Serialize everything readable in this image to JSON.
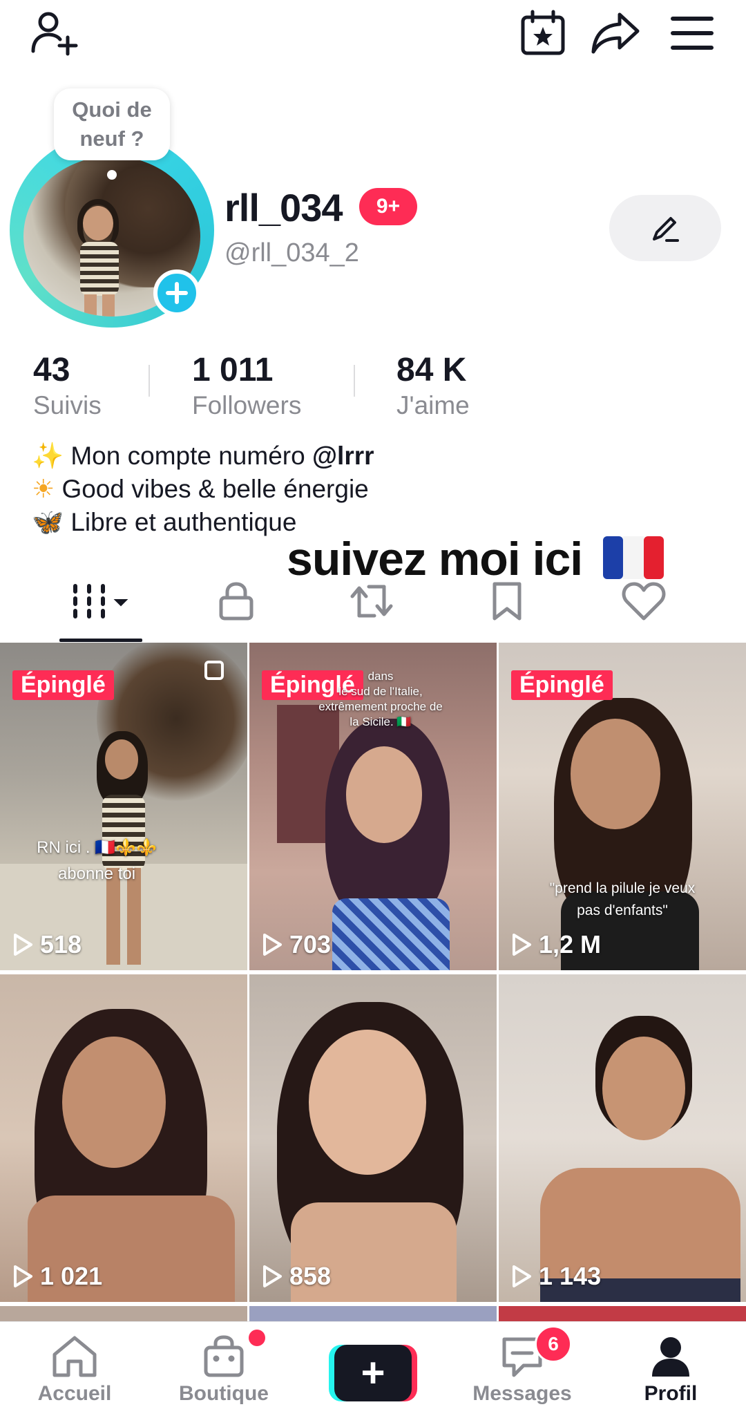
{
  "colors": {
    "accent": "#fe2c55",
    "ring": "#3ad7e8",
    "plus": "#20c2ea",
    "text": "#161823",
    "muted": "#8a8b91"
  },
  "topbar": {
    "icons": [
      "add-user-icon",
      "calendar-star-icon",
      "share-icon",
      "menu-icon"
    ]
  },
  "profile": {
    "bubble_line1": "Quoi de",
    "bubble_line2": "neuf ?",
    "username": "rll_034",
    "notif_badge": "9+",
    "handle": "@rll_034_2",
    "edit_icon": "pencil-icon"
  },
  "stats": [
    {
      "value": "43",
      "label": "Suivis"
    },
    {
      "value": "1 011",
      "label": "Followers"
    },
    {
      "value": "84 K",
      "label": "J'aime"
    }
  ],
  "bio": {
    "line1_emoji": "✨",
    "line1_text": "Mon compte numéro ",
    "line1_mention": "@lrrr",
    "line2_emoji": "☀",
    "line2_text": "Good vibes & belle énergie",
    "line3_emoji": "🦋",
    "line3_text": "Libre et authentique",
    "overlay": "suivez moi ici",
    "overlay_flag": "flag-france-icon"
  },
  "tabs": [
    "videos-grid-icon",
    "lock-icon",
    "repost-icon",
    "bookmark-icon",
    "heart-icon"
  ],
  "videos": [
    {
      "pinned": "Épinglé",
      "views": "518",
      "caption": "RN ici . 🇫🇷⚜️⚜️\nabonne toi"
    },
    {
      "pinned": "Épinglé",
      "views": "703",
      "caption": "dans\nle sud de l'Italie,\nextrêmement proche de\nla Sicile. 🇮🇹"
    },
    {
      "pinned": "Épinglé",
      "views": "1,2 M",
      "caption": "\"prend la pilule je veux\npas d'enfants\""
    },
    {
      "pinned": "",
      "views": "1 021",
      "caption": ""
    },
    {
      "pinned": "",
      "views": "858",
      "caption": ""
    },
    {
      "pinned": "",
      "views": "1 143",
      "caption": ""
    }
  ],
  "nav": {
    "home": "Accueil",
    "shop": "Boutique",
    "messages": "Messages",
    "messages_badge": "6",
    "profile": "Profil",
    "create": "+"
  }
}
